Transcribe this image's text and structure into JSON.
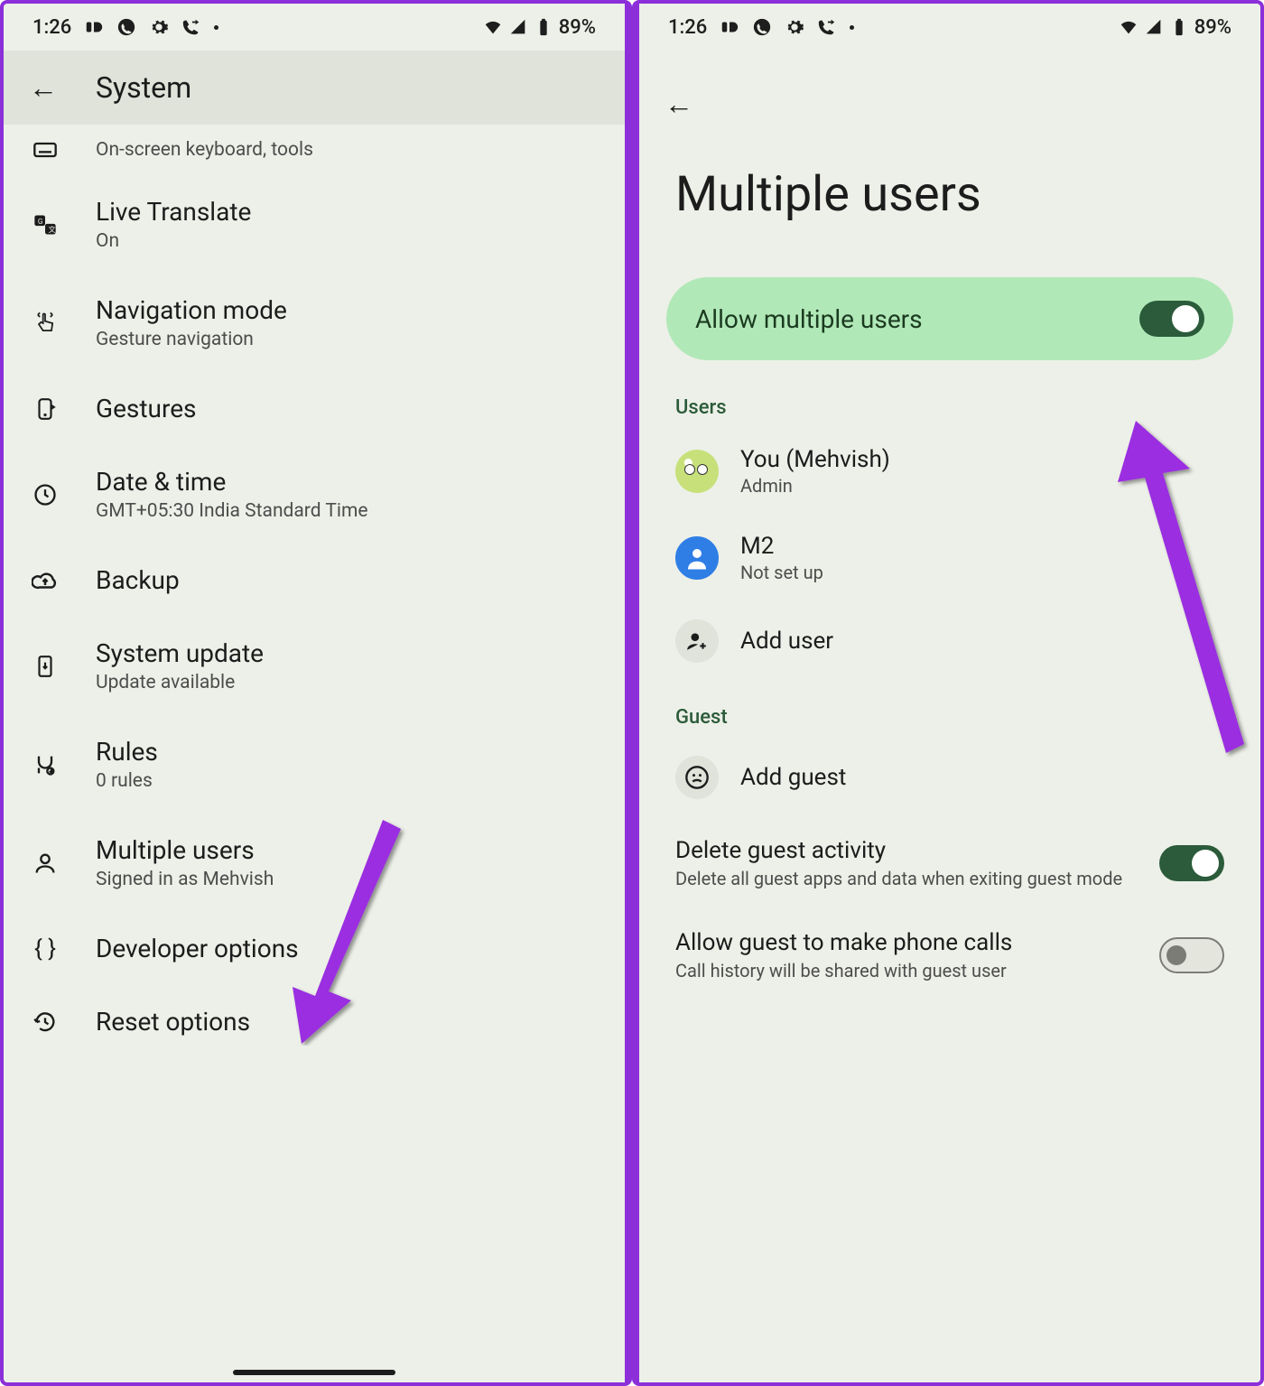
{
  "statusbar": {
    "time": "1:26",
    "battery": "89%"
  },
  "left": {
    "header_title": "System",
    "items": [
      {
        "title": "",
        "sub": "On-screen keyboard, tools"
      },
      {
        "title": "Live Translate",
        "sub": "On"
      },
      {
        "title": "Navigation mode",
        "sub": "Gesture navigation"
      },
      {
        "title": "Gestures",
        "sub": ""
      },
      {
        "title": "Date & time",
        "sub": "GMT+05:30 India Standard Time"
      },
      {
        "title": "Backup",
        "sub": ""
      },
      {
        "title": "System update",
        "sub": "Update available"
      },
      {
        "title": "Rules",
        "sub": "0 rules"
      },
      {
        "title": "Multiple users",
        "sub": "Signed in as Mehvish"
      },
      {
        "title": "Developer options",
        "sub": ""
      },
      {
        "title": "Reset options",
        "sub": ""
      }
    ]
  },
  "right": {
    "page_title": "Multiple users",
    "allow_label": "Allow multiple users",
    "users_section": "Users",
    "user_you": "You (Mehvish)",
    "user_you_sub": "Admin",
    "user_m2": "M2",
    "user_m2_sub": "Not set up",
    "add_user": "Add user",
    "guest_section": "Guest",
    "add_guest": "Add guest",
    "delete_guest_title": "Delete guest activity",
    "delete_guest_sub": "Delete all guest apps and data when exiting guest mode",
    "allow_calls_title": "Allow guest to make phone calls",
    "allow_calls_sub": "Call history will be shared with guest user"
  }
}
